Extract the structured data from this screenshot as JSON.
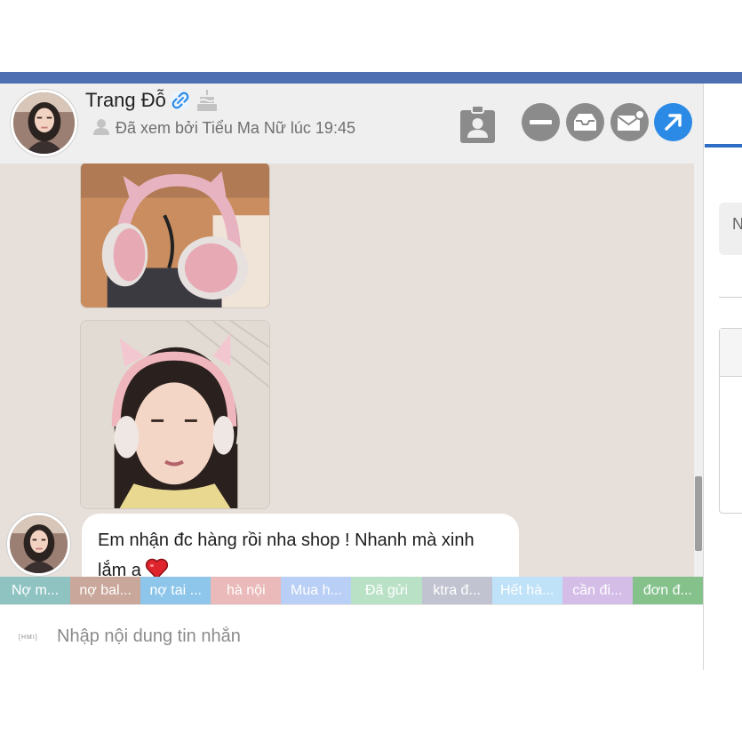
{
  "header": {
    "contact_name": "Trang Đỗ",
    "seen_status": "Đã xem bởi Tiểu Ma Nữ lúc 19:45"
  },
  "messages": [
    {
      "type": "image",
      "description": "headphones-photo"
    },
    {
      "type": "image",
      "description": "selfie-photo"
    },
    {
      "type": "text",
      "text": "Em nhận đc hàng rồi nha shop ! Nhanh mà xinh lắm a"
    }
  ],
  "labels": [
    {
      "text": "Nợ m...",
      "color": "#8fc3c2"
    },
    {
      "text": "nợ bal...",
      "color": "#c9a79a"
    },
    {
      "text": "nợ tai ...",
      "color": "#8dc6ea"
    },
    {
      "text": "hà nội",
      "color": "#eab9b9"
    },
    {
      "text": "Mua h...",
      "color": "#b9cff6"
    },
    {
      "text": "Đã gửi",
      "color": "#b9e1c6"
    },
    {
      "text": "ktra đ...",
      "color": "#c1c3d1"
    },
    {
      "text": "Hết hà...",
      "color": "#bfe2f8"
    },
    {
      "text": "cần đi...",
      "color": "#d4bde7"
    },
    {
      "text": "đơn đ...",
      "color": "#84c18b"
    }
  ],
  "composer": {
    "tag": "[HMI]",
    "placeholder": "Nhập nội dung tin nhắn"
  },
  "side_panel": {
    "field_text": "N"
  },
  "icons": [
    "link-icon",
    "cake-icon",
    "user-icon",
    "contact-card-icon",
    "minimize-icon",
    "inbox-icon",
    "mail-notification-icon",
    "expand-icon",
    "heart-icon"
  ],
  "colors": {
    "accent": "#2b8ae6",
    "top_bar": "#4f6fb3",
    "chat_background": "#e6dfda"
  }
}
